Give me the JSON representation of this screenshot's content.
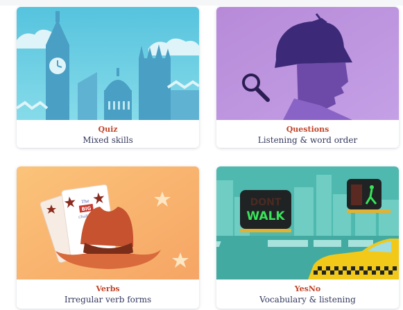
{
  "cards": [
    {
      "title": "Quiz",
      "subtitle": "Mixed skills",
      "image": "london-skyline-illustration"
    },
    {
      "title": "Questions",
      "subtitle": "Listening & word order",
      "image": "detective-silhouette-illustration"
    },
    {
      "title": "Verbs",
      "subtitle": "Irregular verb forms",
      "image": "cowboy-hat-and-cards-illustration",
      "card_text": [
        "The",
        "BIG",
        "Challenge"
      ]
    },
    {
      "title": "YesNo",
      "subtitle": "Vocabulary & listening",
      "image": "city-crosswalk-illustration",
      "sign_text": [
        "DONT",
        "WALK"
      ]
    }
  ],
  "colors": {
    "title": "#c0452a",
    "subtitle": "#34395e"
  }
}
